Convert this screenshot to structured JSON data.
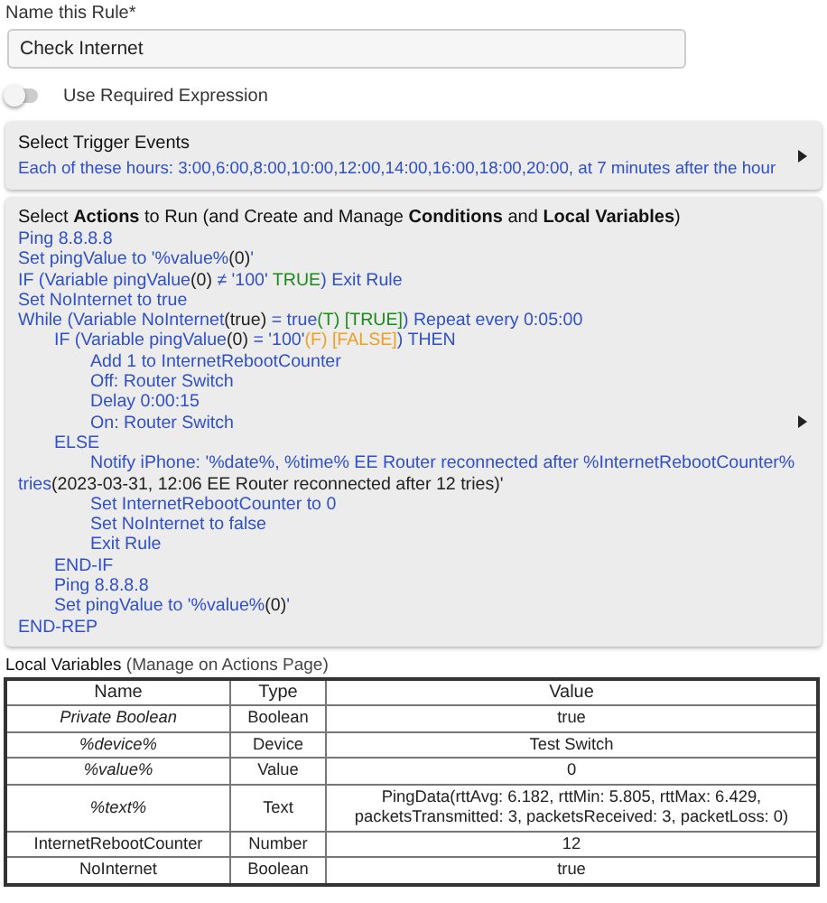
{
  "rule_name": {
    "label": "Name this Rule*",
    "value": "Check Internet"
  },
  "required_expression": {
    "label": "Use Required Expression",
    "on": false
  },
  "trigger": {
    "title": "Select Trigger Events",
    "description": "Each of these hours: 3:00,6:00,8:00,10:00,12:00,14:00,16:00,18:00,20:00, at 7 minutes after the hour"
  },
  "actions": {
    "title": "Select **Actions** to Run (and Create and Manage **Conditions** and **Local Variables**)",
    "lines": [
      {
        "segments": [
          {
            "kind": "code",
            "text": "Ping 8.8.8.8"
          }
        ]
      },
      {
        "segments": [
          {
            "kind": "code",
            "text": "Set pingValue to '%value%"
          },
          {
            "kind": "value",
            "text": "(0)"
          },
          {
            "kind": "code",
            "text": "'"
          }
        ]
      },
      {
        "segments": [
          {
            "kind": "code",
            "text": "IF (Variable pingValue"
          },
          {
            "kind": "value",
            "text": "(0)"
          },
          {
            "kind": "code",
            "text": " ≠ '100' "
          },
          {
            "kind": "true",
            "text": "TRUE"
          },
          {
            "kind": "code",
            "text": ") Exit Rule"
          }
        ]
      },
      {
        "segments": [
          {
            "kind": "code",
            "text": "Set NoInternet to true"
          }
        ]
      },
      {
        "segments": [
          {
            "kind": "code",
            "text": "While (Variable NoInternet"
          },
          {
            "kind": "value",
            "text": "(true)"
          },
          {
            "kind": "code",
            "text": " = true"
          },
          {
            "kind": "true",
            "text": "(T) [TRUE]"
          },
          {
            "kind": "code",
            "text": ") Repeat every 0:05:00"
          }
        ],
        "children": [
          {
            "segments": [
              {
                "kind": "code",
                "text": "IF (Variable pingValue"
              },
              {
                "kind": "value",
                "text": "(0)"
              },
              {
                "kind": "code",
                "text": " = '100'"
              },
              {
                "kind": "false",
                "text": "(F) [FALSE]"
              },
              {
                "kind": "code",
                "text": ") THEN"
              }
            ],
            "children": [
              {
                "segments": [
                  {
                    "kind": "code",
                    "text": "Add 1 to InternetRebootCounter"
                  }
                ]
              },
              {
                "segments": [
                  {
                    "kind": "code",
                    "text": "Off: Router Switch"
                  }
                ]
              },
              {
                "segments": [
                  {
                    "kind": "code",
                    "text": "Delay 0:00:15"
                  }
                ]
              },
              {
                "segments": [
                  {
                    "kind": "code",
                    "text": "On: Router Switch"
                  }
                ]
              }
            ]
          },
          {
            "segments": [
              {
                "kind": "code",
                "text": "ELSE"
              }
            ],
            "children": [
              {
                "segments": [
                  {
                    "kind": "code",
                    "text": "Notify iPhone: '%date%, %time% EE Router reconnected after %InternetRebootCounter% tries"
                  },
                  {
                    "kind": "value",
                    "text": "(2023-03-31, 12:06 EE Router reconnected after 12 tries)'"
                  }
                ]
              },
              {
                "segments": [
                  {
                    "kind": "code",
                    "text": "Set InternetRebootCounter to 0"
                  }
                ]
              },
              {
                "segments": [
                  {
                    "kind": "code",
                    "text": "Set NoInternet to false"
                  }
                ]
              },
              {
                "segments": [
                  {
                    "kind": "code",
                    "text": "Exit Rule"
                  }
                ]
              }
            ]
          },
          {
            "segments": [
              {
                "kind": "code",
                "text": "END-IF"
              }
            ]
          },
          {
            "segments": [
              {
                "kind": "code",
                "text": "Ping 8.8.8.8"
              }
            ]
          },
          {
            "segments": [
              {
                "kind": "code",
                "text": "Set pingValue to '%value%"
              },
              {
                "kind": "value",
                "text": "(0)"
              },
              {
                "kind": "code",
                "text": "'"
              }
            ]
          }
        ]
      },
      {
        "segments": [
          {
            "kind": "code",
            "text": "END-REP"
          }
        ]
      }
    ]
  },
  "local_variables": {
    "title": "Local Variables",
    "note": "(Manage on Actions Page)",
    "columns": [
      "Name",
      "Type",
      "Value"
    ],
    "rows": [
      {
        "kind": "builtin",
        "name": "Private Boolean",
        "type": "Boolean",
        "value": "true"
      },
      {
        "kind": "builtin",
        "name": "%device%",
        "type": "Device",
        "value": "Test Switch"
      },
      {
        "kind": "builtin",
        "name": "%value%",
        "type": "Value",
        "value": "0"
      },
      {
        "kind": "builtin",
        "name": "%text%",
        "type": "Text",
        "value": "PingData(rttAvg: 6.182, rttMin: 5.805, rttMax: 6.429, packetsTransmitted: 3, packetsReceived: 3, packetLoss: 0)"
      },
      {
        "kind": "user",
        "name": "InternetRebootCounter",
        "type": "Number",
        "value": "12"
      },
      {
        "kind": "user",
        "name": "NoInternet",
        "type": "Boolean",
        "value": "true"
      }
    ]
  }
}
